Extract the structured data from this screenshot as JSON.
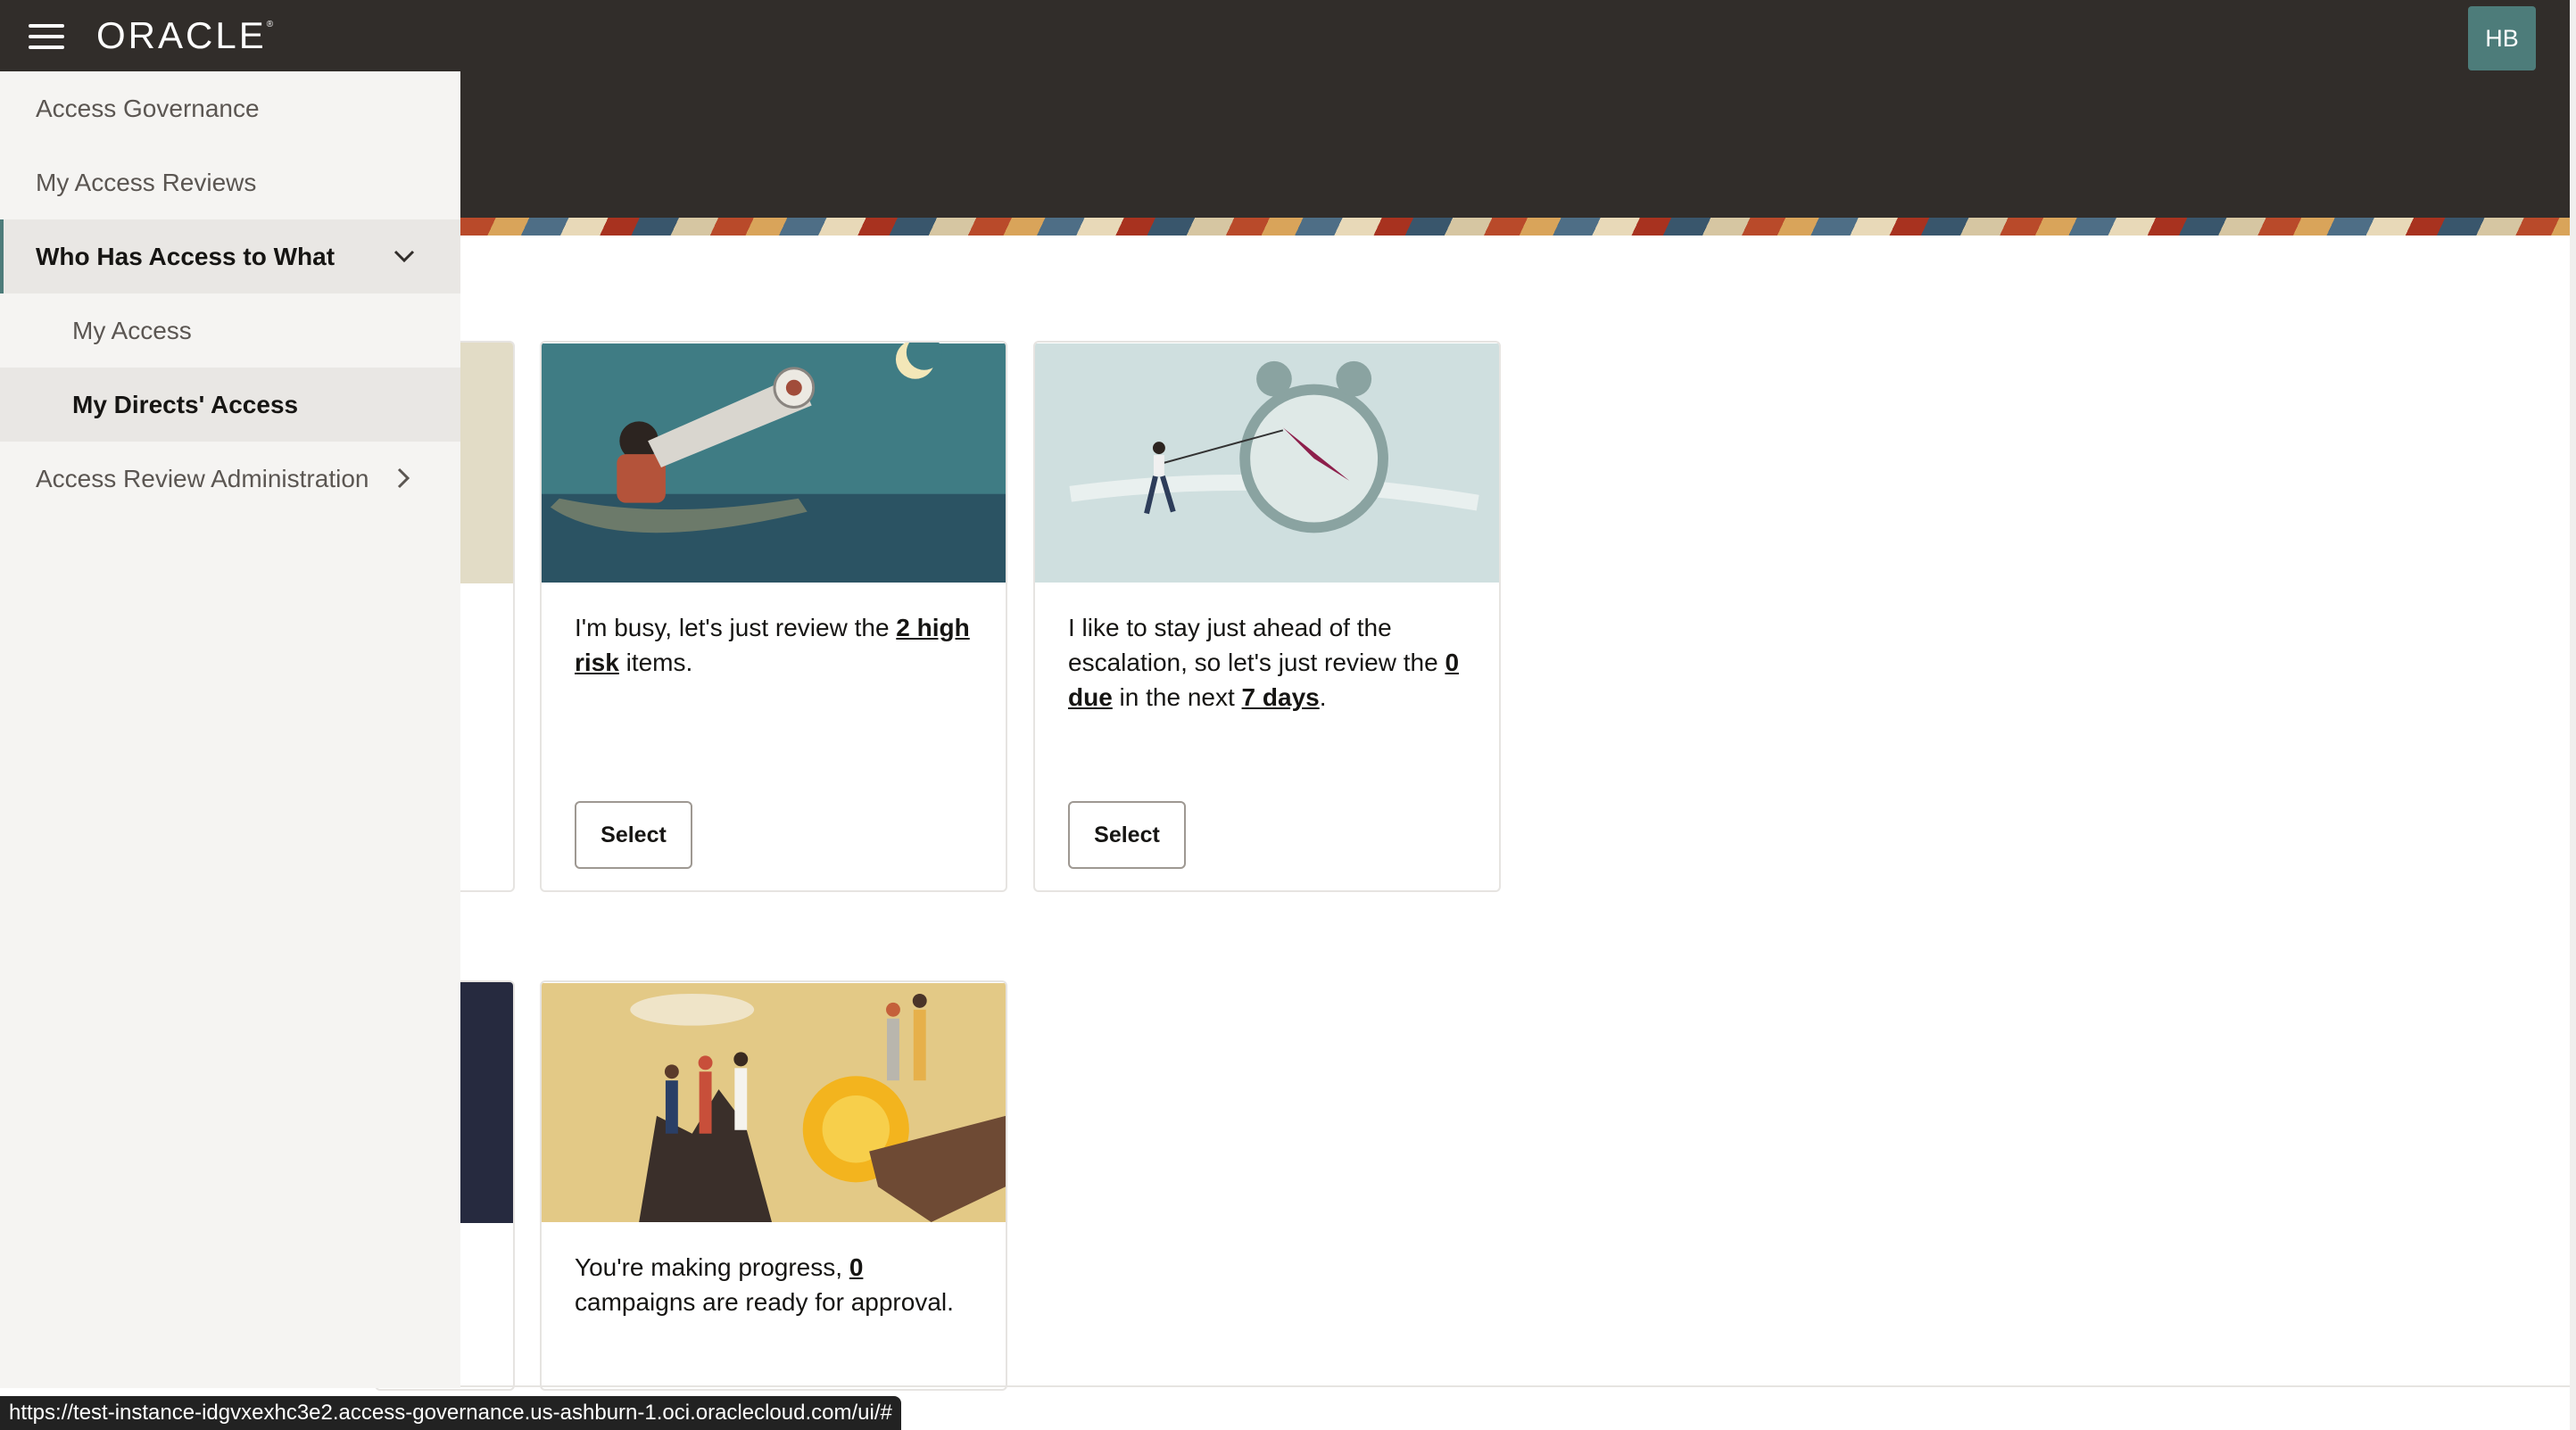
{
  "header": {
    "logo_text": "ORACLE",
    "logo_mark": "®",
    "avatar_initials": "HB"
  },
  "sidebar": {
    "items": [
      {
        "label": "Access Governance"
      },
      {
        "label": "My Access Reviews"
      },
      {
        "label": "Who Has Access to What",
        "expanded": true,
        "children": [
          {
            "label": "My Access"
          },
          {
            "label": "My Directs' Access",
            "selected": true
          }
        ]
      },
      {
        "label": "Access Review Administration"
      }
    ]
  },
  "cards": {
    "high_risk": {
      "text_before": "I'm busy, let's just review the ",
      "link": "2 high risk",
      "text_after": " items.",
      "button": "Select"
    },
    "escalation": {
      "text_before": "I like to stay just ahead of the escalation, so let's just review the ",
      "link_due": "0 due",
      "text_middle": " in the next ",
      "link_days": "7 days",
      "text_after": ".",
      "button": "Select"
    },
    "progress": {
      "text_before": "You're making progress, ",
      "link": "0",
      "text_after": " campaigns are ready for approval."
    }
  },
  "statusbar": {
    "url": "https://test-instance-idgvxexhc3e2.access-governance.us-ashburn-1.oci.oraclecloud.com/ui/#"
  },
  "colors": {
    "header_bg": "#312d2a",
    "nav_bg": "#f5f4f2",
    "nav_selected_bg": "#e9e7e4",
    "accent": "#4d7c7a"
  }
}
